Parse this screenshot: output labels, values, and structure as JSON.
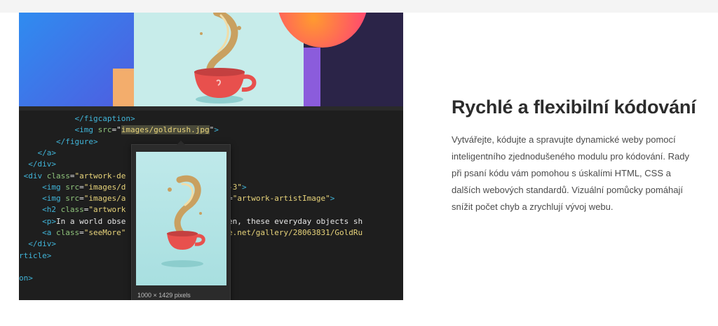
{
  "code_lines": [
    {
      "indent": "            ",
      "parts": [
        {
          "c": "tag",
          "t": "</figcaption>"
        }
      ]
    },
    {
      "indent": "            ",
      "parts": [
        {
          "c": "tag",
          "t": "<img "
        },
        {
          "c": "attr",
          "t": "src"
        },
        {
          "c": "txt",
          "t": "=\""
        },
        {
          "c": "sel",
          "t": "images/goldrush.jpg"
        },
        {
          "c": "txt",
          "t": "\""
        },
        {
          "c": "tag",
          "t": ">"
        }
      ]
    },
    {
      "indent": "        ",
      "parts": [
        {
          "c": "tag",
          "t": "</figure>"
        }
      ]
    },
    {
      "indent": "    ",
      "parts": [
        {
          "c": "tag",
          "t": "</a>"
        }
      ]
    },
    {
      "indent": "  ",
      "parts": [
        {
          "c": "tag",
          "t": "</div>"
        }
      ]
    },
    {
      "indent": " ",
      "parts": [
        {
          "c": "tag",
          "t": "<div "
        },
        {
          "c": "attr",
          "t": "class"
        },
        {
          "c": "txt",
          "t": "="
        },
        {
          "c": "str",
          "t": "\"artwork-de"
        }
      ]
    },
    {
      "indent": "     ",
      "parts": [
        {
          "c": "tag",
          "t": "<img "
        },
        {
          "c": "attr",
          "t": "src"
        },
        {
          "c": "txt",
          "t": "="
        },
        {
          "c": "str",
          "t": "\"images/d"
        },
        {
          "c": "txt",
          "t": "                   "
        },
        {
          "c": "str",
          "t": "dot-3\""
        },
        {
          "c": "tag",
          "t": ">"
        }
      ]
    },
    {
      "indent": "     ",
      "parts": [
        {
          "c": "tag",
          "t": "<img "
        },
        {
          "c": "attr",
          "t": "src"
        },
        {
          "c": "txt",
          "t": "="
        },
        {
          "c": "str",
          "t": "\"images/a"
        },
        {
          "c": "txt",
          "t": "                 "
        },
        {
          "c": "attr",
          "t": "class"
        },
        {
          "c": "txt",
          "t": "="
        },
        {
          "c": "str",
          "t": "\"artwork-artistImage\""
        },
        {
          "c": "tag",
          "t": ">"
        }
      ]
    },
    {
      "indent": "     ",
      "parts": [
        {
          "c": "tag",
          "t": "<h2 "
        },
        {
          "c": "attr",
          "t": "class"
        },
        {
          "c": "txt",
          "t": "="
        },
        {
          "c": "str",
          "t": "\"artwork"
        }
      ]
    },
    {
      "indent": "     ",
      "parts": [
        {
          "c": "tag",
          "t": "<p>"
        },
        {
          "c": "txt",
          "t": "In a world obse                g golden, these everyday objects sh"
        }
      ]
    },
    {
      "indent": "     ",
      "parts": [
        {
          "c": "tag",
          "t": "<a "
        },
        {
          "c": "attr",
          "t": "class"
        },
        {
          "c": "txt",
          "t": "="
        },
        {
          "c": "str",
          "t": "\"seeMore\""
        },
        {
          "c": "txt",
          "t": "                "
        },
        {
          "c": "str",
          "t": "behance.net/gallery/28063831/GoldRu"
        }
      ]
    },
    {
      "indent": "  ",
      "parts": [
        {
          "c": "tag",
          "t": "</div>"
        }
      ]
    },
    {
      "indent": "",
      "parts": [
        {
          "c": "tag",
          "t": "rticle>"
        }
      ]
    },
    {
      "indent": "",
      "parts": []
    },
    {
      "indent": "",
      "parts": [
        {
          "c": "tag",
          "t": "on>"
        }
      ]
    }
  ],
  "popup": {
    "caption": "1000 × 1429 pixels"
  },
  "content": {
    "title": "Rychlé a flexibilní kódování",
    "description_lines": [
      "Vytvářejte, kódujte a spravujte dynamické weby pomocí",
      "inteligentního zjednodušeného modulu pro kódování. Rady",
      "při psaní kódu vám pomohou s úskalími HTML, CSS a",
      "dalších webových standardů. Vizuální pomůcky pomáhají",
      "snížit počet chyb a zrychlují vývoj webu."
    ]
  },
  "colors": {
    "tag": "#40b4d8",
    "attr": "#8ec27a",
    "string": "#e7d37a",
    "editor_bg": "#1e1e1e"
  }
}
